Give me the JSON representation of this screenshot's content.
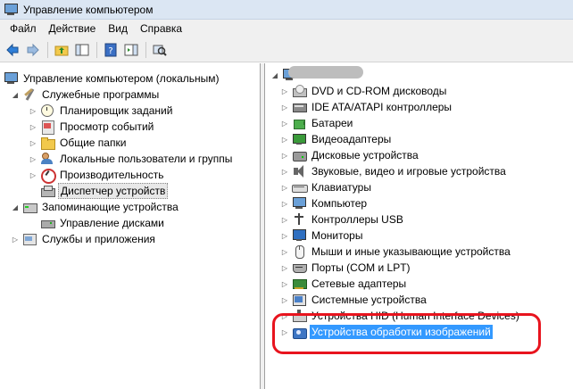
{
  "window": {
    "title": "Управление компьютером"
  },
  "menu": [
    "Файл",
    "Действие",
    "Вид",
    "Справка"
  ],
  "toolbar": {
    "buttons": [
      "back-arrow-icon",
      "forward-arrow-icon",
      "up-folder-icon",
      "show-tree-icon",
      "help-icon",
      "action-pane-icon",
      "scan-hardware-icon"
    ]
  },
  "left_tree": [
    {
      "label": "Управление компьютером (локальным)",
      "icon": "computer-icon",
      "expander": "",
      "level": 0
    },
    {
      "label": "Служебные программы",
      "icon": "tools-icon",
      "expander": "◢",
      "level": 1
    },
    {
      "label": "Планировщик заданий",
      "icon": "clock-icon",
      "expander": "▷",
      "level": 2
    },
    {
      "label": "Просмотр событий",
      "icon": "event-viewer-icon",
      "expander": "▷",
      "level": 2
    },
    {
      "label": "Общие папки",
      "icon": "folder-icon",
      "expander": "▷",
      "level": 2
    },
    {
      "label": "Локальные пользователи и группы",
      "icon": "users-icon",
      "expander": "▷",
      "level": 2
    },
    {
      "label": "Производительность",
      "icon": "performance-icon",
      "expander": "▷",
      "level": 2
    },
    {
      "label": "Диспетчер устройств",
      "icon": "device-manager-icon",
      "expander": "",
      "level": 2,
      "selected": true
    },
    {
      "label": "Запоминающие устройства",
      "icon": "storage-icon",
      "expander": "◢",
      "level": 1
    },
    {
      "label": "Управление дисками",
      "icon": "disk-icon",
      "expander": "",
      "level": 2
    },
    {
      "label": "Службы и приложения",
      "icon": "services-icon",
      "expander": "▷",
      "level": 1
    }
  ],
  "right_tree": [
    {
      "label": "DVD и CD-ROM дисководы",
      "icon": "dvd-icon"
    },
    {
      "label": "IDE ATA/ATAPI контроллеры",
      "icon": "ide-controller-icon"
    },
    {
      "label": "Батареи",
      "icon": "battery-icon"
    },
    {
      "label": "Видеоадаптеры",
      "icon": "video-adapter-icon"
    },
    {
      "label": "Дисковые устройства",
      "icon": "hard-disk-icon"
    },
    {
      "label": "Звуковые, видео и игровые устройства",
      "icon": "speaker-icon"
    },
    {
      "label": "Клавиатуры",
      "icon": "keyboard-icon"
    },
    {
      "label": "Компьютер",
      "icon": "computer-icon"
    },
    {
      "label": "Контроллеры USB",
      "icon": "usb-icon"
    },
    {
      "label": "Мониторы",
      "icon": "monitor-icon"
    },
    {
      "label": "Мыши и иные указывающие устройства",
      "icon": "mouse-icon"
    },
    {
      "label": "Порты (COM и LPT)",
      "icon": "port-icon"
    },
    {
      "label": "Сетевые адаптеры",
      "icon": "network-adapter-icon"
    },
    {
      "label": "Системные устройства",
      "icon": "system-devices-icon"
    },
    {
      "label": "Устройства HID (Human Interface Devices)",
      "icon": "hid-icon"
    },
    {
      "label": "Устройства обработки изображений",
      "icon": "camera-icon",
      "highlighted": true
    }
  ],
  "expander_collapsed": "▷",
  "colors": {
    "highlight": "#3399ff",
    "annotation": "#e8141e"
  }
}
